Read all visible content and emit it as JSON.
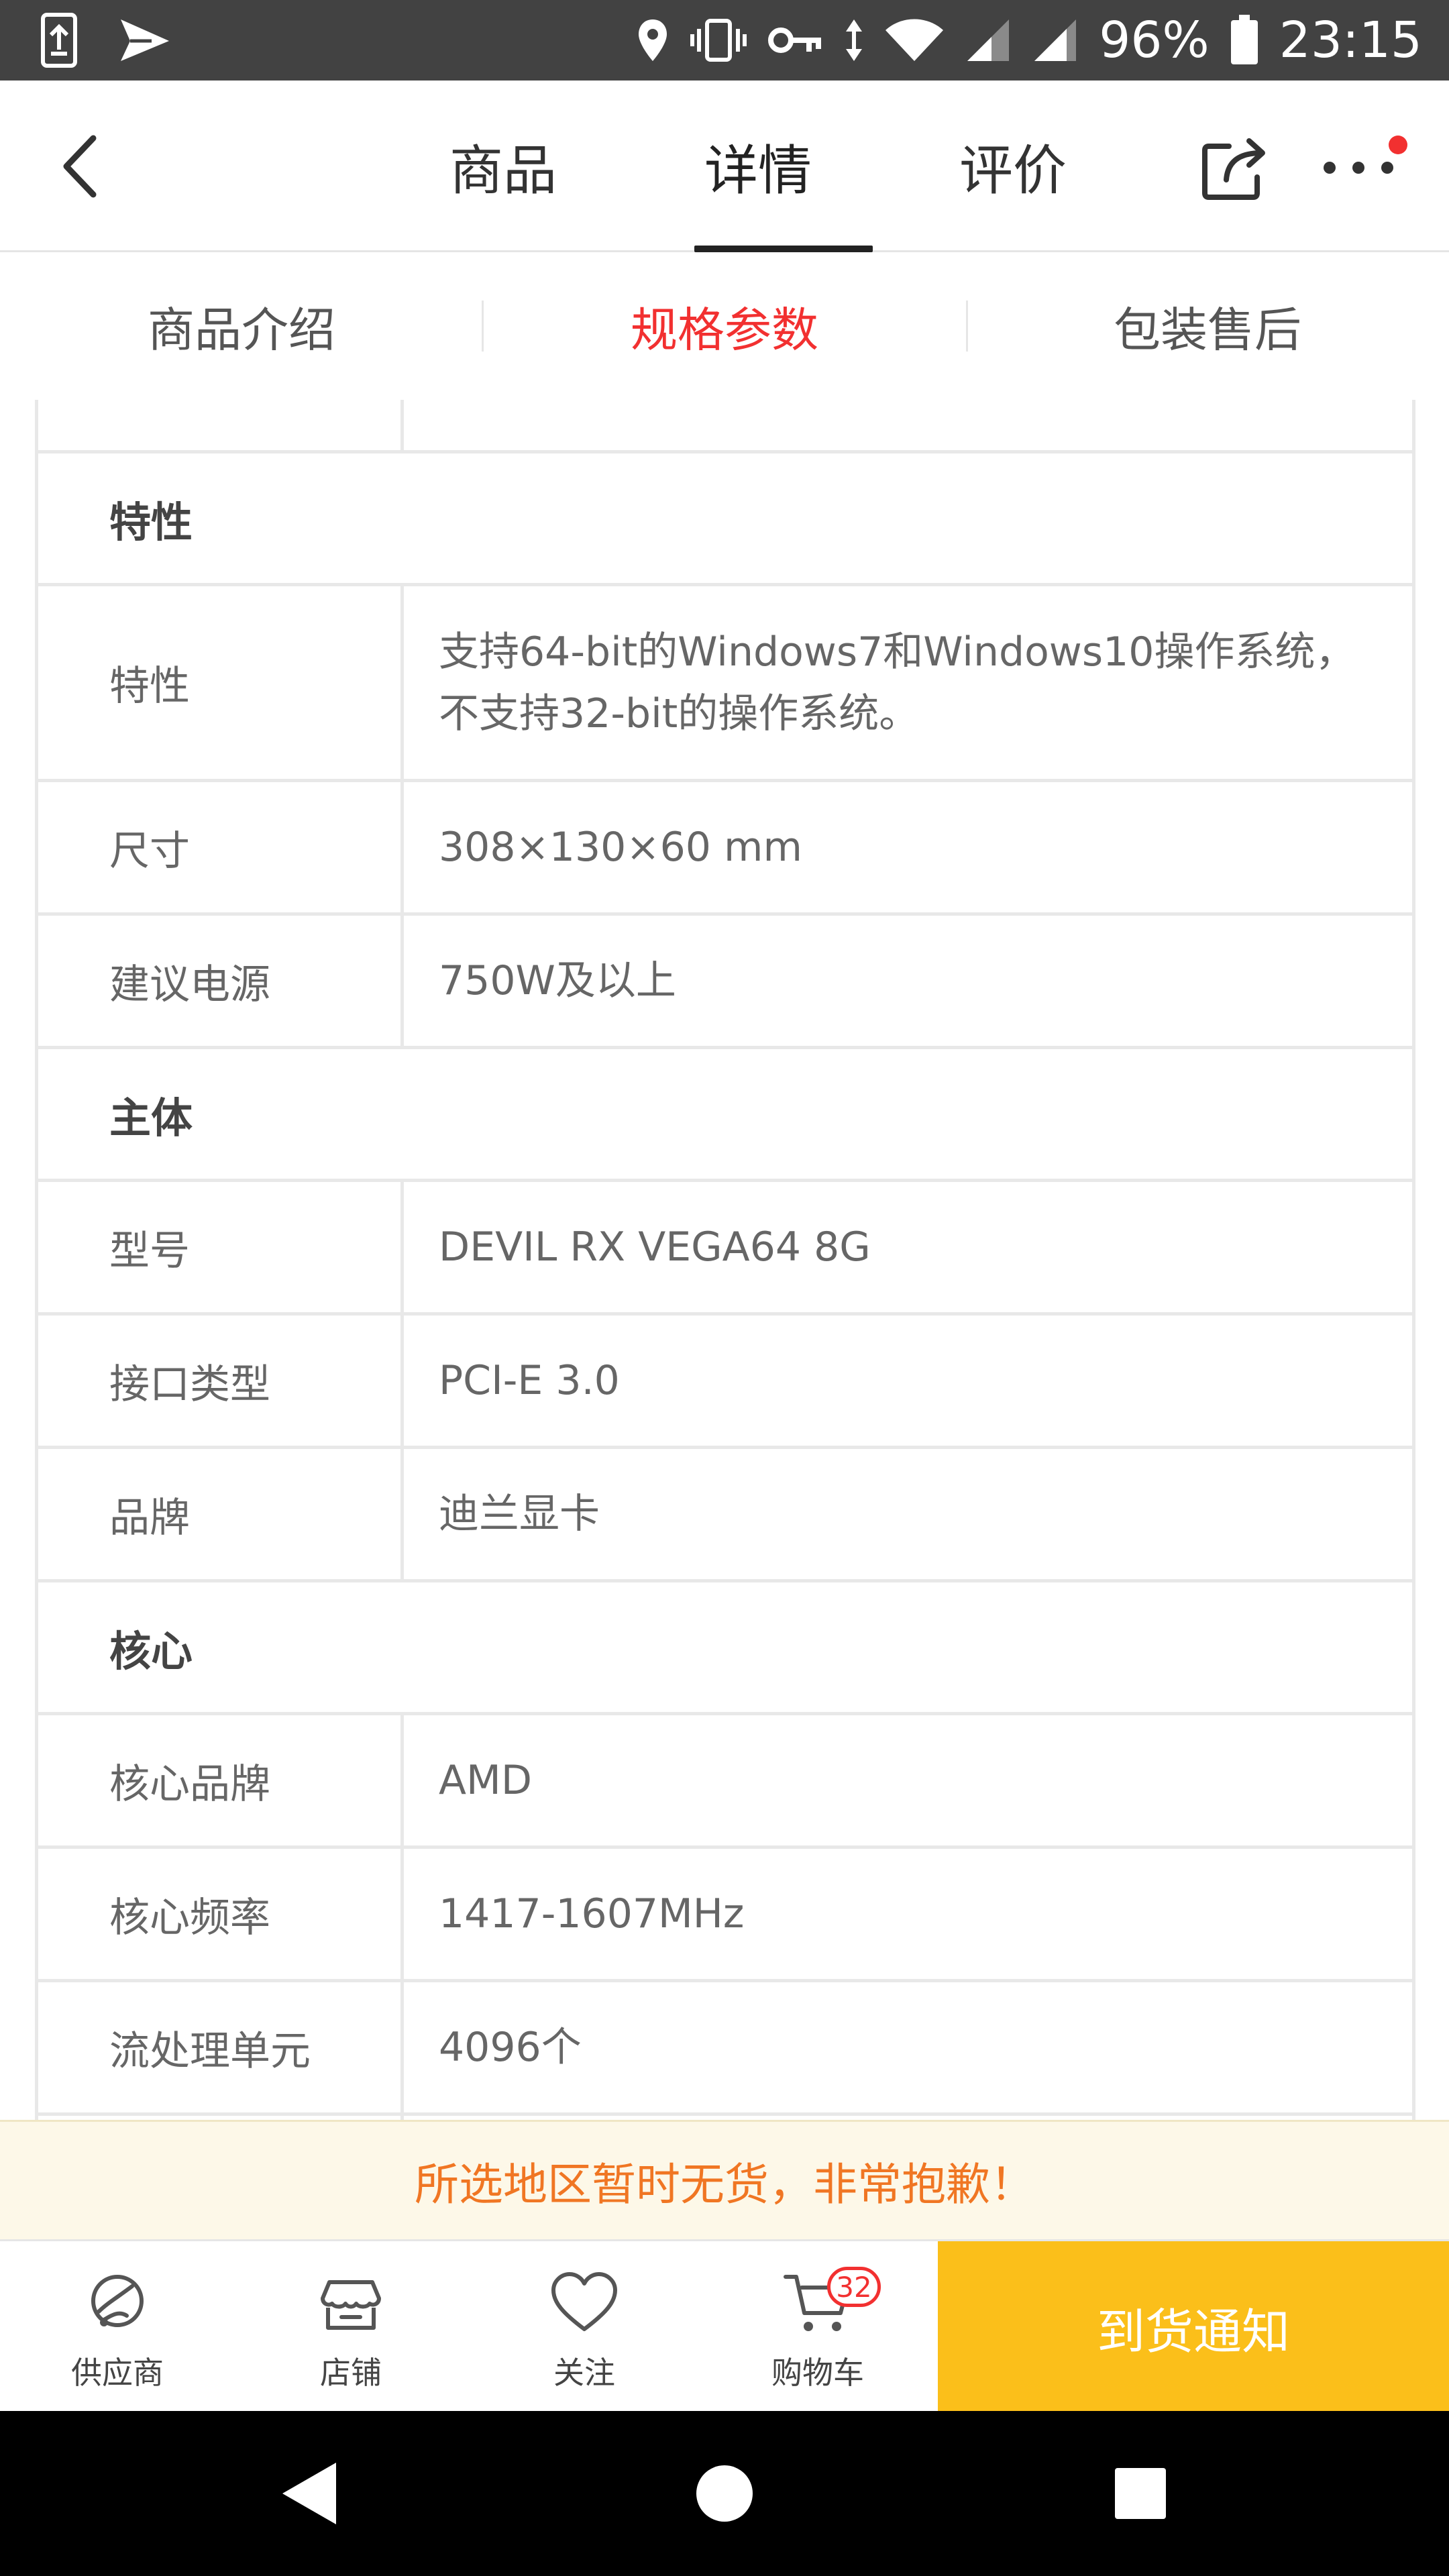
{
  "status_bar": {
    "battery": "96%",
    "time": "23:15"
  },
  "header": {
    "tabs": [
      {
        "label": "商品"
      },
      {
        "label": "详情"
      },
      {
        "label": "评价"
      }
    ],
    "active_tab": "详情"
  },
  "subtabs": {
    "items": [
      {
        "label": "商品介绍"
      },
      {
        "label": "规格参数"
      },
      {
        "label": "包装售后"
      }
    ],
    "active": "规格参数"
  },
  "specs": {
    "section_features": "特性",
    "features": [
      {
        "label": "特性",
        "value": "支持64-bit的Windows7和Windows10操作系统，不支持32-bit的操作系统。"
      },
      {
        "label": "尺寸",
        "value": "308×130×60 mm"
      },
      {
        "label": "建议电源",
        "value": "750W及以上"
      }
    ],
    "section_main": "主体",
    "main": [
      {
        "label": "型号",
        "value": "DEVIL RX VEGA64 8G"
      },
      {
        "label": "接口类型",
        "value": "PCI-E 3.0"
      },
      {
        "label": "品牌",
        "value": "迪兰显卡"
      }
    ],
    "section_core": "核心",
    "core": [
      {
        "label": "核心品牌",
        "value": "AMD"
      },
      {
        "label": "核心频率",
        "value": "1417-1607MHz"
      },
      {
        "label": "流处理单元",
        "value": "4096个"
      }
    ]
  },
  "notice": "所选地区暂时无货，非常抱歉！",
  "bottom_bar": {
    "supplier": "供应商",
    "store": "店铺",
    "follow": "关注",
    "cart": "购物车",
    "cart_count": "32",
    "notify": "到货通知"
  },
  "colors": {
    "accent_red": "#f23030",
    "notify_yellow": "#fbbf1a",
    "notice_text": "#f07623"
  }
}
